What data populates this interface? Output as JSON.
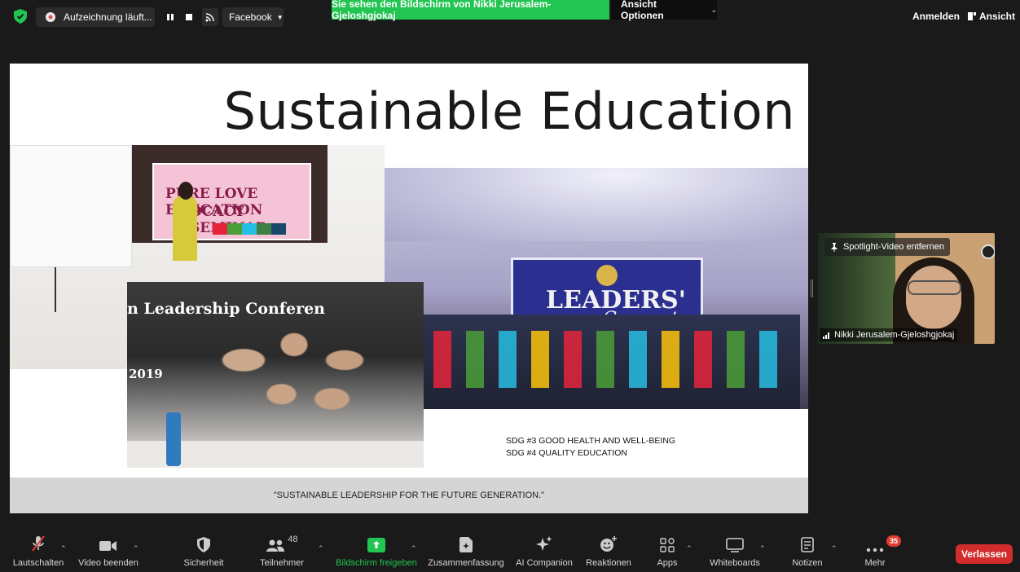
{
  "topbar": {
    "recording_label": "Aufzeichnung läuft...",
    "live_label": "Facebook",
    "share_banner": "Sie sehen den Bildschirm von Nikki Jerusalem-Gjeloshgjokaj",
    "view_options": "Ansicht Optionen",
    "sign_in": "Anmelden",
    "view": "Ansicht"
  },
  "slide": {
    "title": "Sustainable Education",
    "sdg_line1": "SDG #3 GOOD HEALTH AND WELL-BEING",
    "sdg_line2": "SDG #4 QUALITY EDUCATION",
    "quote": "\"SUSTAINABLE LEADERSHIP FOR THE FUTURE GENERATION.\"",
    "photo1_banner_line1": "PURE LOVE EDUCATION",
    "photo1_banner_line2": "OCACY SEMINAR",
    "photo2_sign_line1": "LEADERS'",
    "photo2_sign_line2": "Connect",
    "photo3_banner": "n Leadership Conferen",
    "photo3_year": "2019"
  },
  "participant": {
    "spotlight_button": "Spotlight-Video entfernen",
    "name": "Nikki Jerusalem-Gjeloshgjokaj"
  },
  "toolbar": {
    "items": [
      {
        "label": "Lautschalten",
        "icon": "microphone-muted-icon"
      },
      {
        "label": "Video beenden",
        "icon": "video-camera-icon"
      },
      {
        "label": "Sicherheit",
        "icon": "shield-icon"
      },
      {
        "label": "Teilnehmer",
        "icon": "participants-icon",
        "count": "48"
      },
      {
        "label": "Bildschirm freigeben",
        "icon": "share-screen-icon"
      },
      {
        "label": "Zusammenfassung",
        "icon": "summary-icon"
      },
      {
        "label": "AI Companion",
        "icon": "sparkle-icon"
      },
      {
        "label": "Reaktionen",
        "icon": "emoji-icon"
      },
      {
        "label": "Apps",
        "icon": "apps-icon"
      },
      {
        "label": "Whiteboards",
        "icon": "whiteboard-icon"
      },
      {
        "label": "Notizen",
        "icon": "notes-icon"
      },
      {
        "label": "Mehr",
        "icon": "more-icon",
        "badge": "35"
      }
    ],
    "leave": "Verlassen"
  },
  "colors": {
    "share_green": "#23c552",
    "leave_red": "#d32c2c",
    "background": "#1a1a1a"
  }
}
